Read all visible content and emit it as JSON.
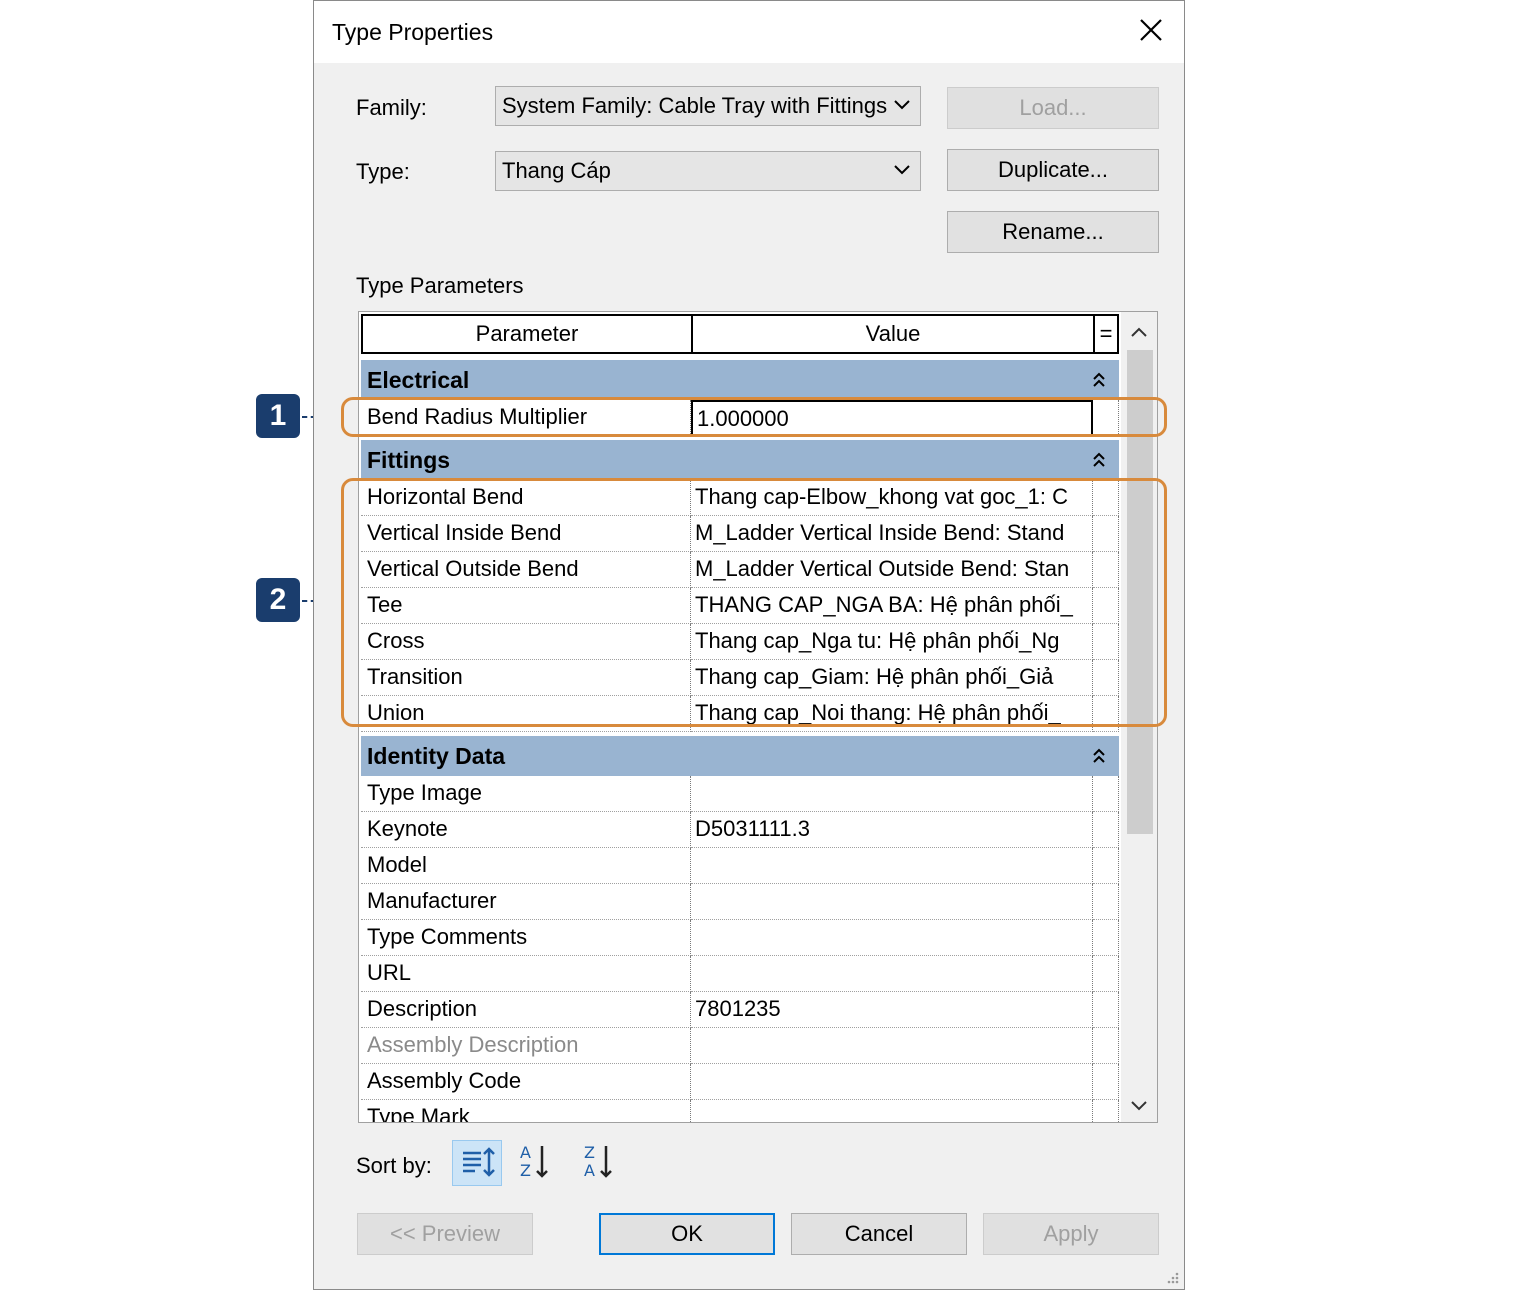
{
  "window": {
    "title": "Type Properties"
  },
  "family": {
    "label": "Family:",
    "value": "System Family: Cable Tray with Fittings"
  },
  "type": {
    "label": "Type:",
    "value": "Thang Cáp"
  },
  "buttons": {
    "load": "Load...",
    "duplicate": "Duplicate...",
    "rename": "Rename...",
    "preview": "<< Preview",
    "ok": "OK",
    "cancel": "Cancel",
    "apply": "Apply"
  },
  "type_parameters_label": "Type Parameters",
  "grid": {
    "header": {
      "parameter": "Parameter",
      "value": "Value",
      "eq": "="
    },
    "categories": [
      {
        "name": "Electrical",
        "rows": [
          {
            "param": "Bend Radius Multiplier",
            "value": "1.000000"
          }
        ]
      },
      {
        "name": "Fittings",
        "rows": [
          {
            "param": "Horizontal Bend",
            "value": "Thang cap-Elbow_khong vat goc_1: C"
          },
          {
            "param": "Vertical Inside Bend",
            "value": "M_Ladder Vertical Inside Bend: Stand"
          },
          {
            "param": "Vertical Outside Bend",
            "value": "M_Ladder Vertical Outside Bend: Stan"
          },
          {
            "param": "Tee",
            "value": "THANG CAP_NGA BA: Hệ phân phối_"
          },
          {
            "param": "Cross",
            "value": "Thang cap_Nga tu: Hệ phân phối_Ng"
          },
          {
            "param": "Transition",
            "value": "Thang cap_Giam: Hệ phân phối_Giả"
          },
          {
            "param": "Union",
            "value": "Thang cap_Noi thang: Hệ phân phối_"
          }
        ]
      },
      {
        "name": "Identity Data",
        "rows": [
          {
            "param": "Type Image",
            "value": ""
          },
          {
            "param": "Keynote",
            "value": "D5031111.3"
          },
          {
            "param": "Model",
            "value": ""
          },
          {
            "param": "Manufacturer",
            "value": ""
          },
          {
            "param": "Type Comments",
            "value": ""
          },
          {
            "param": "URL",
            "value": ""
          },
          {
            "param": "Description",
            "value": "7801235"
          },
          {
            "param": "Assembly Description",
            "value": ""
          },
          {
            "param": "Assembly Code",
            "value": ""
          },
          {
            "param": "Type Mark",
            "value": ""
          }
        ]
      }
    ]
  },
  "sort": {
    "label": "Sort by:"
  },
  "callouts": {
    "one": "1",
    "two": "2"
  },
  "colors": {
    "category_bg": "#99b4d1",
    "highlight": "#d88a3c",
    "marker": "#1a3d6d",
    "default_button": "#0078d7"
  }
}
